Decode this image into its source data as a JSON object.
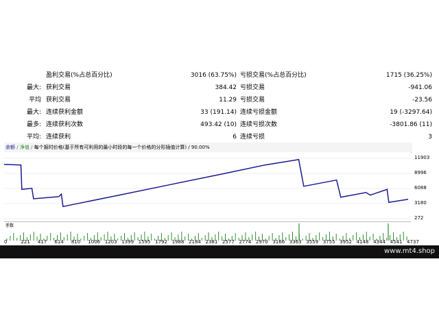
{
  "stats": [
    {
      "prefix": "",
      "left_label": "盈利交易(%占总百分比)",
      "left_value": "3016 (63.75%)",
      "right_label": "亏损交易(%占总百分比)",
      "right_value": "1715 (36.25%)"
    },
    {
      "prefix": "最大:",
      "left_label": "获利交易",
      "left_value": "384.42",
      "right_label": "亏损交易",
      "right_value": "-941.06"
    },
    {
      "prefix": "平均",
      "left_label": "获利交易",
      "left_value": "11.29",
      "right_label": "亏损交易",
      "right_value": "-23.56"
    },
    {
      "prefix": "最大:",
      "left_label": "连续获利金额",
      "left_value": "33 (191.14)",
      "right_label": "连续亏损金额",
      "right_value": "19 (-3297.64)"
    },
    {
      "prefix": "最多:",
      "left_label": "连续获利次数",
      "left_value": "493.42 (10)",
      "right_label": "连续亏损次数",
      "right_value": "-3801.86 (11)"
    },
    {
      "prefix": "平均:",
      "left_label": "连续获利",
      "left_value": "6",
      "right_label": "连续亏损",
      "right_value": "3"
    }
  ],
  "chart_header": {
    "balance_label": "余额",
    "equity_label": "净值",
    "description": "每个报时价格(基于所有可利用的最小时段的每一个价格的分形插值计算) / 90.00%"
  },
  "chart_data": {
    "type": "line",
    "series": [
      {
        "name": "余额",
        "color": "#1a1a8f"
      }
    ],
    "y_ticks": [
      "11903",
      "8996",
      "6088",
      "3180",
      "272"
    ],
    "x_ticks": [
      "0",
      "221",
      "417",
      "614",
      "810",
      "1006",
      "1203",
      "1399",
      "1595",
      "1792",
      "1988",
      "2184",
      "2381",
      "2577",
      "2774",
      "2970",
      "3166",
      "3363",
      "3559",
      "3755",
      "3952",
      "4148",
      "4344",
      "4541",
      "4737"
    ],
    "volume_label": "手数",
    "balance_points": [
      [
        0,
        10700
      ],
      [
        200,
        10600
      ],
      [
        210,
        5900
      ],
      [
        330,
        6100
      ],
      [
        350,
        4100
      ],
      [
        650,
        4500
      ],
      [
        680,
        5000
      ],
      [
        700,
        2600
      ],
      [
        820,
        3000
      ],
      [
        1400,
        4900
      ],
      [
        2000,
        6900
      ],
      [
        2600,
        8900
      ],
      [
        3100,
        10600
      ],
      [
        3500,
        11650
      ],
      [
        3560,
        6500
      ],
      [
        3950,
        7700
      ],
      [
        4000,
        4400
      ],
      [
        4300,
        5300
      ],
      [
        4350,
        4800
      ],
      [
        4550,
        5900
      ],
      [
        4570,
        3400
      ],
      [
        4800,
        4000
      ]
    ]
  },
  "watermark": "www.mt4.shop"
}
